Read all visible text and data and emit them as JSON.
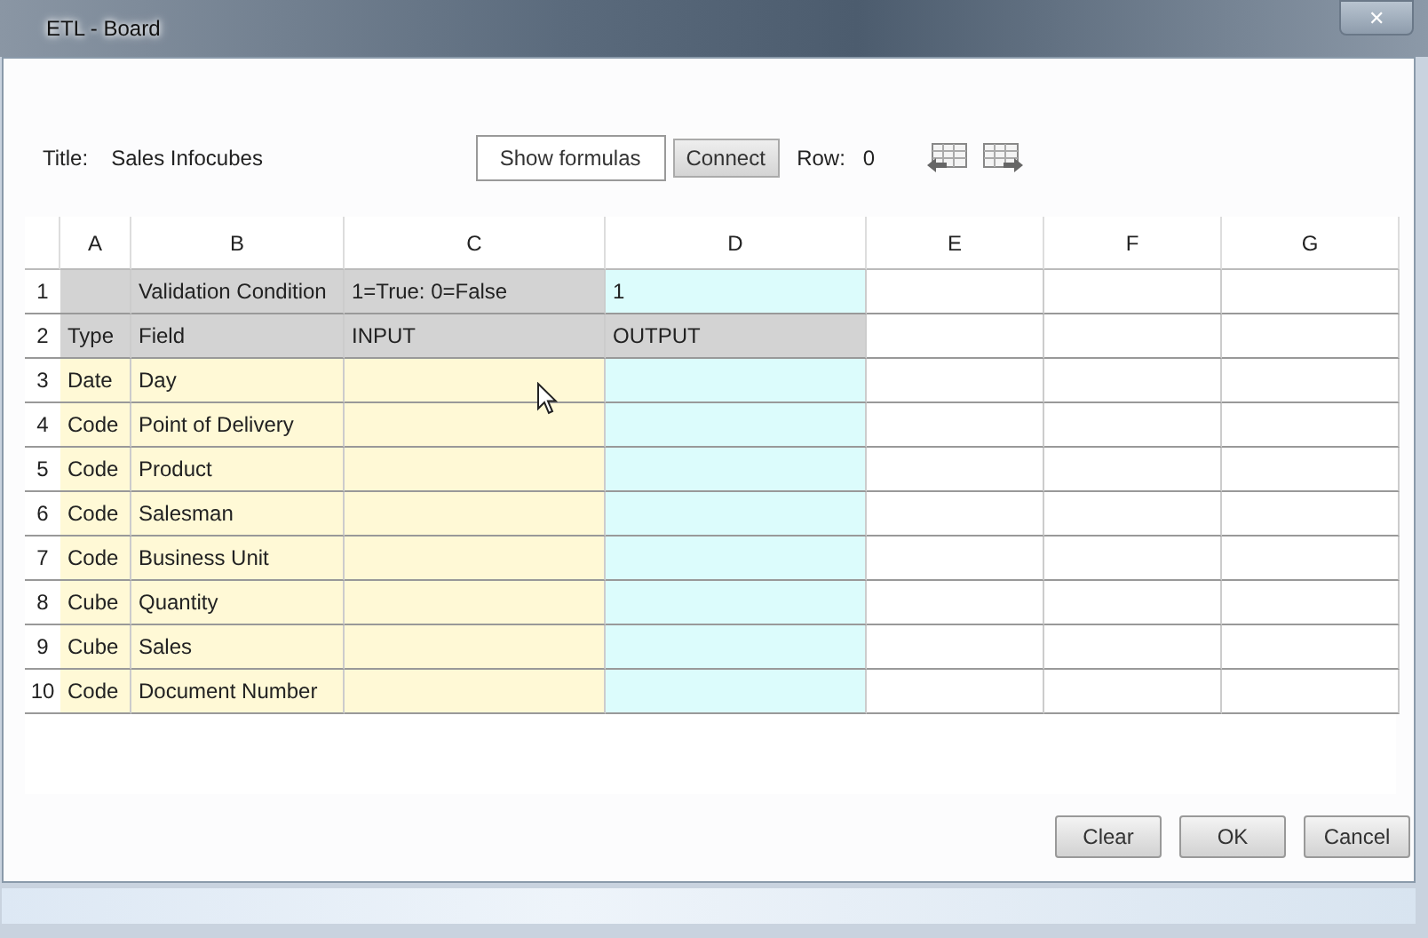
{
  "window": {
    "title": "ETL - Board",
    "close": "✕"
  },
  "toolbar": {
    "title_label": "Title:",
    "title_value": "Sales Infocubes",
    "show_formulas": "Show formulas",
    "connect": "Connect",
    "row_label": "Row:",
    "row_value": "0"
  },
  "grid": {
    "columns": [
      "A",
      "B",
      "C",
      "D",
      "E",
      "F",
      "G"
    ],
    "rows": [
      {
        "number": "1",
        "cells": [
          {
            "kind": "label"
          },
          {
            "kind": "label",
            "text": "Validation Condition"
          },
          {
            "kind": "label",
            "text": "1=True: 0=False"
          },
          {
            "kind": "output",
            "text": "1"
          },
          {
            "kind": "empty"
          },
          {
            "kind": "empty"
          },
          {
            "kind": "empty"
          }
        ]
      },
      {
        "number": "2",
        "cells": [
          {
            "kind": "label",
            "text": "Type"
          },
          {
            "kind": "label",
            "text": "Field"
          },
          {
            "kind": "label",
            "text": "INPUT"
          },
          {
            "kind": "label",
            "text": "OUTPUT"
          },
          {
            "kind": "empty"
          },
          {
            "kind": "empty"
          },
          {
            "kind": "empty"
          }
        ]
      },
      {
        "number": "3",
        "cells": [
          {
            "kind": "input",
            "text": "Date"
          },
          {
            "kind": "input",
            "text": "Day"
          },
          {
            "kind": "input"
          },
          {
            "kind": "output"
          },
          {
            "kind": "empty"
          },
          {
            "kind": "empty"
          },
          {
            "kind": "empty"
          }
        ]
      },
      {
        "number": "4",
        "cells": [
          {
            "kind": "input",
            "text": "Code"
          },
          {
            "kind": "input",
            "text": "Point of Delivery"
          },
          {
            "kind": "input"
          },
          {
            "kind": "output"
          },
          {
            "kind": "empty"
          },
          {
            "kind": "empty"
          },
          {
            "kind": "empty"
          }
        ]
      },
      {
        "number": "5",
        "cells": [
          {
            "kind": "input",
            "text": "Code"
          },
          {
            "kind": "input",
            "text": "Product"
          },
          {
            "kind": "input"
          },
          {
            "kind": "output"
          },
          {
            "kind": "empty"
          },
          {
            "kind": "empty"
          },
          {
            "kind": "empty"
          }
        ]
      },
      {
        "number": "6",
        "cells": [
          {
            "kind": "input",
            "text": "Code"
          },
          {
            "kind": "input",
            "text": "Salesman"
          },
          {
            "kind": "input"
          },
          {
            "kind": "output"
          },
          {
            "kind": "empty"
          },
          {
            "kind": "empty"
          },
          {
            "kind": "empty"
          }
        ]
      },
      {
        "number": "7",
        "cells": [
          {
            "kind": "input",
            "text": "Code"
          },
          {
            "kind": "input",
            "text": "Business Unit"
          },
          {
            "kind": "input"
          },
          {
            "kind": "output"
          },
          {
            "kind": "empty"
          },
          {
            "kind": "empty"
          },
          {
            "kind": "empty"
          }
        ]
      },
      {
        "number": "8",
        "cells": [
          {
            "kind": "input",
            "text": "Cube"
          },
          {
            "kind": "input",
            "text": "Quantity"
          },
          {
            "kind": "input"
          },
          {
            "kind": "output"
          },
          {
            "kind": "empty"
          },
          {
            "kind": "empty"
          },
          {
            "kind": "empty"
          }
        ]
      },
      {
        "number": "9",
        "cells": [
          {
            "kind": "input",
            "text": "Cube"
          },
          {
            "kind": "input",
            "text": "Sales"
          },
          {
            "kind": "input"
          },
          {
            "kind": "output"
          },
          {
            "kind": "empty"
          },
          {
            "kind": "empty"
          },
          {
            "kind": "empty"
          }
        ]
      },
      {
        "number": "10",
        "cells": [
          {
            "kind": "input",
            "text": "Code"
          },
          {
            "kind": "input",
            "text": "Document Number"
          },
          {
            "kind": "input"
          },
          {
            "kind": "output"
          },
          {
            "kind": "empty"
          },
          {
            "kind": "empty"
          },
          {
            "kind": "empty"
          }
        ]
      }
    ]
  },
  "buttons": [
    "Clear",
    "OK",
    "Cancel"
  ]
}
